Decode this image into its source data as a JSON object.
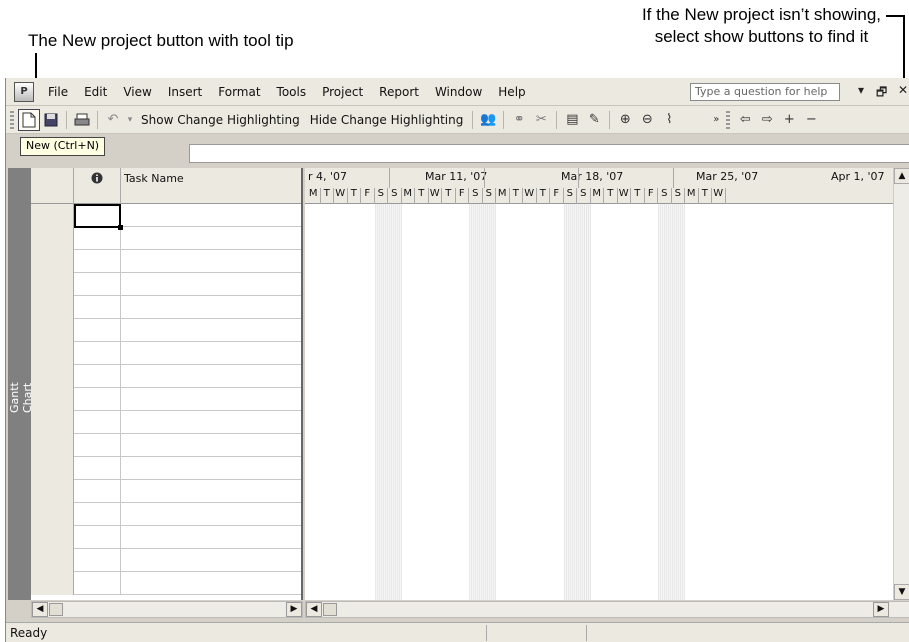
{
  "callouts": {
    "left": "The New project button with tool tip",
    "right_line1": "If the New project isn’t showing,",
    "right_line2": "select show buttons to find it"
  },
  "menu": {
    "items": [
      "File",
      "Edit",
      "View",
      "Insert",
      "Format",
      "Tools",
      "Project",
      "Report",
      "Window",
      "Help"
    ],
    "help_placeholder": "Type a question for help"
  },
  "toolbar": {
    "show_change_label": "Show Change Highlighting",
    "hide_change_label": "Hide Change Highlighting"
  },
  "tooltip": "New (Ctrl+N)",
  "table": {
    "indicator_icon": "info-icon",
    "name_header": "Task Name"
  },
  "timescale": {
    "weeks": [
      "r 4, '07",
      "Mar 11, '07",
      "Mar 18, '07",
      "Mar 25, '07",
      "Apr 1, '07"
    ],
    "days": [
      "M",
      "T",
      "W",
      "T",
      "F",
      "S",
      "S",
      "M",
      "T",
      "W",
      "T",
      "F",
      "S",
      "S",
      "M",
      "T",
      "W",
      "T",
      "F",
      "S",
      "S",
      "M",
      "T",
      "W",
      "T",
      "F",
      "S",
      "S",
      "M",
      "T",
      "W"
    ]
  },
  "view_bar_label": "Gantt Chart",
  "status": "Ready"
}
